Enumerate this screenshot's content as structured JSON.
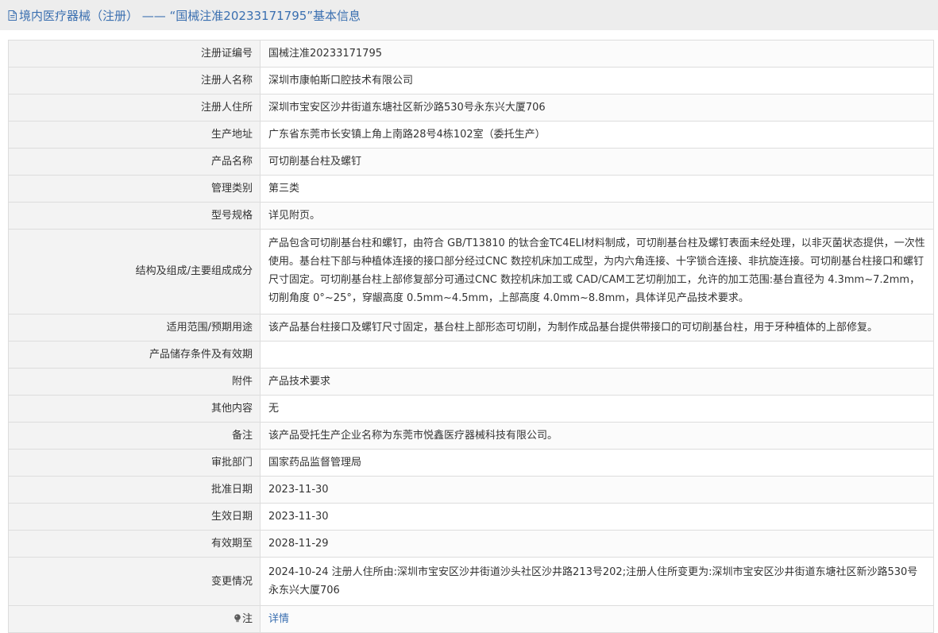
{
  "header": {
    "title": "境内医疗器械（注册） —— “国械注准20233171795”基本信息",
    "icon": "document-icon",
    "accent_color": "#3a6fb0"
  },
  "rows": [
    {
      "label": "注册证编号",
      "value": "国械注准20233171795"
    },
    {
      "label": "注册人名称",
      "value": "深圳市康帕斯口腔技术有限公司"
    },
    {
      "label": "注册人住所",
      "value": "深圳市宝安区沙井街道东塘社区新沙路530号永东兴大厦706"
    },
    {
      "label": "生产地址",
      "value": "广东省东莞市长安镇上角上南路28号4栋102室（委托生产）"
    },
    {
      "label": "产品名称",
      "value": "可切削基台柱及螺钉"
    },
    {
      "label": "管理类别",
      "value": "第三类"
    },
    {
      "label": "型号规格",
      "value": "详见附页。"
    },
    {
      "label": "结构及组成/主要组成成分",
      "value": "产品包含可切削基台柱和螺钉，由符合 GB/T13810 的钛合金TC4ELI材料制成，可切削基台柱及螺钉表面未经处理，以非灭菌状态提供，一次性使用。基台柱下部与种植体连接的接口部分经过CNC 数控机床加工成型，为内六角连接、十字锁合连接、非抗旋连接。可切削基台柱接口和螺钉尺寸固定。可切削基台柱上部修复部分可通过CNC 数控机床加工或 CAD/CAM工艺切削加工，允许的加工范围:基台直径为 4.3mm~7.2mm，切削角度 0°~25°，穿龈高度 0.5mm~4.5mm，上部高度 4.0mm~8.8mm，具体详见产品技术要求。"
    },
    {
      "label": "适用范围/预期用途",
      "value": "该产品基台柱接口及螺钉尺寸固定，基台柱上部形态可切削，为制作成品基台提供带接口的可切削基台柱，用于牙种植体的上部修复。"
    },
    {
      "label": "产品储存条件及有效期",
      "value": ""
    },
    {
      "label": "附件",
      "value": "产品技术要求"
    },
    {
      "label": "其他内容",
      "value": "无"
    },
    {
      "label": "备注",
      "value": "该产品受托生产企业名称为东莞市悦鑫医疗器械科技有限公司。"
    },
    {
      "label": "审批部门",
      "value": "国家药品监督管理局"
    },
    {
      "label": "批准日期",
      "value": "2023-11-30"
    },
    {
      "label": "生效日期",
      "value": "2023-11-30"
    },
    {
      "label": "有效期至",
      "value": "2028-11-29"
    },
    {
      "label": "变更情况",
      "value": "2024-10-24 注册人住所由:深圳市宝安区沙井街道沙头社区沙井路213号202;注册人住所变更为:深圳市宝安区沙井街道东塘社区新沙路530号永东兴大厦706"
    }
  ],
  "note_row": {
    "label": "注",
    "icon": "lightbulb-icon",
    "link_text": "详情"
  }
}
